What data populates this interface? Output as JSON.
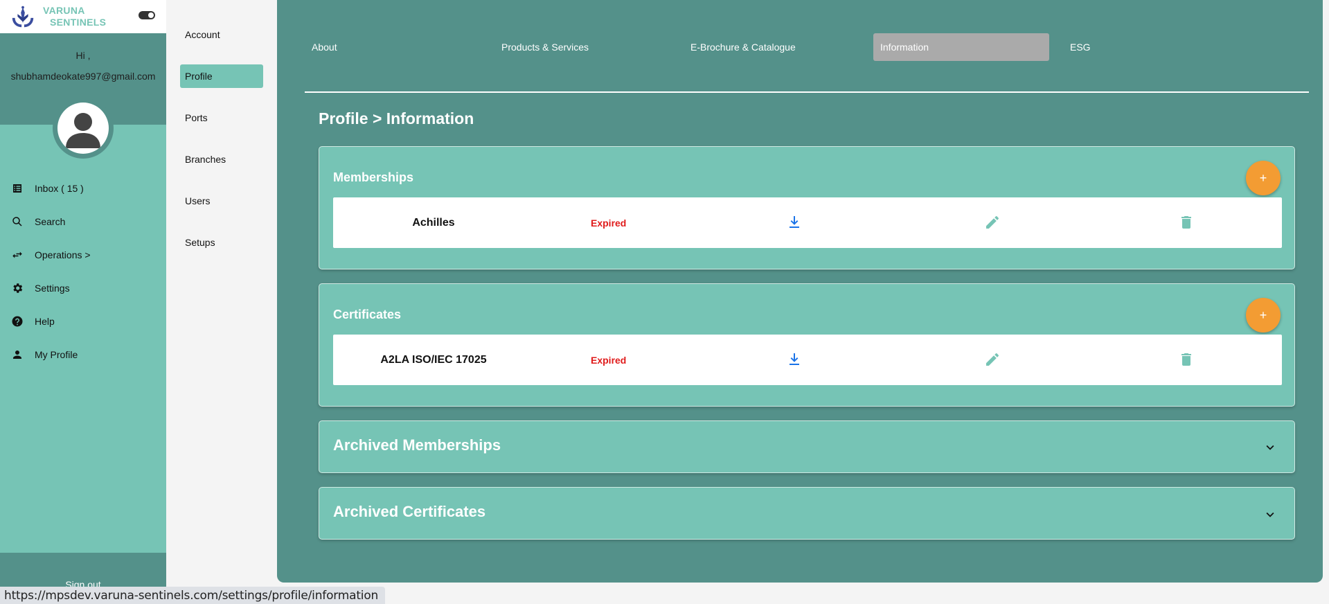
{
  "app": {
    "logo_line1": "VARUNA",
    "logo_line2": "SENTINELS"
  },
  "user": {
    "greeting": "Hi ,",
    "email": "shubhamdeokate997@gmail.com"
  },
  "sidebar": {
    "items": [
      {
        "label": "Inbox ( 15 )",
        "icon": "inbox-icon"
      },
      {
        "label": "Search",
        "icon": "search-icon"
      },
      {
        "label": "Operations >",
        "icon": "swap-arrows-icon"
      },
      {
        "label": "Settings",
        "icon": "gear-icon"
      },
      {
        "label": "Help",
        "icon": "help-icon"
      },
      {
        "label": "My Profile",
        "icon": "person-icon"
      }
    ],
    "signout": "Sign out"
  },
  "subnav": {
    "items": [
      "Account",
      "Profile",
      "Ports",
      "Branches",
      "Users",
      "Setups"
    ],
    "active": "Profile"
  },
  "tabs": {
    "items": [
      "About",
      "Products & Services",
      "E-Brochure & Catalogue",
      "Information",
      "ESG"
    ],
    "active": "Information"
  },
  "page": {
    "title": "Profile > Information"
  },
  "memberships": {
    "title": "Memberships",
    "add_label": "+",
    "rows": [
      {
        "name": "Achilles",
        "status": "Expired"
      }
    ]
  },
  "certificates": {
    "title": "Certificates",
    "add_label": "+",
    "rows": [
      {
        "name": "A2LA ISO/IEC 17025",
        "status": "Expired"
      }
    ]
  },
  "archived_memberships": {
    "title": "Archived Memberships"
  },
  "archived_certificates": {
    "title": "Archived Certificates"
  },
  "status_bar": {
    "url": "https://mpsdev.varuna-sentinels.com/settings/profile/information"
  },
  "colors": {
    "teal_light": "#76c4b5",
    "teal_dark": "#54918a",
    "accent_orange": "#f39c33",
    "expired_red": "#e01b1b",
    "download_blue": "#1a73e8"
  }
}
